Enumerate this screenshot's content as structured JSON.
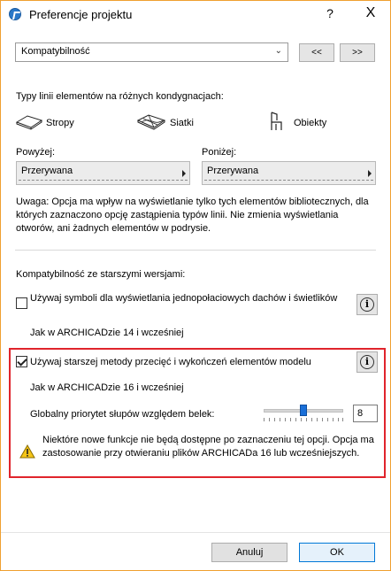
{
  "window": {
    "title": "Preferencje projektu",
    "help_label": "?",
    "close_label": "X"
  },
  "page_selector": {
    "value": "Kompatybilność",
    "prev_label": "<<",
    "next_label": ">>"
  },
  "linetypes": {
    "heading": "Typy linii elementów na różnych kondygnacjach:",
    "categories": [
      {
        "label": "Stropy",
        "icon": "slab-icon"
      },
      {
        "label": "Siatki",
        "icon": "mesh-icon"
      },
      {
        "label": "Obiekty",
        "icon": "chair-icon"
      }
    ],
    "above": {
      "label": "Powyżej:",
      "value": "Przerywana"
    },
    "below": {
      "label": "Poniżej:",
      "value": "Przerywana"
    },
    "note": "Uwaga: Opcja ma wpływ na wyświetlanie tylko tych elementów bibliotecznych, dla których zaznaczono opcję zastąpienia typów linii. Nie zmienia wyświetlania otworów, ani żadnych elementów w podrysie."
  },
  "compat": {
    "heading": "Kompatybilność ze starszymi wersjami:",
    "option1": {
      "label": "Używaj symboli dla wyświetlania jednopołaciowych dachów i świetlików",
      "checked": false,
      "sub": "Jak w ARCHICADzie 14 i wcześniej"
    },
    "option2": {
      "label": "Używaj starszej metody przecięć i wykończeń elementów modelu",
      "checked": true,
      "sub": "Jak w ARCHICADzie 16 i wcześniej",
      "priority_label": "Globalny priorytet słupów względem belek:",
      "priority_value": "8",
      "warning": "Niektóre nowe funkcje nie będą dostępne po zaznaczeniu tej opcji. Opcja ma zastosowanie przy otwieraniu plików ARCHICADa 16 lub wcześniejszych."
    }
  },
  "footer": {
    "cancel_label": "Anuluj",
    "ok_label": "OK"
  }
}
